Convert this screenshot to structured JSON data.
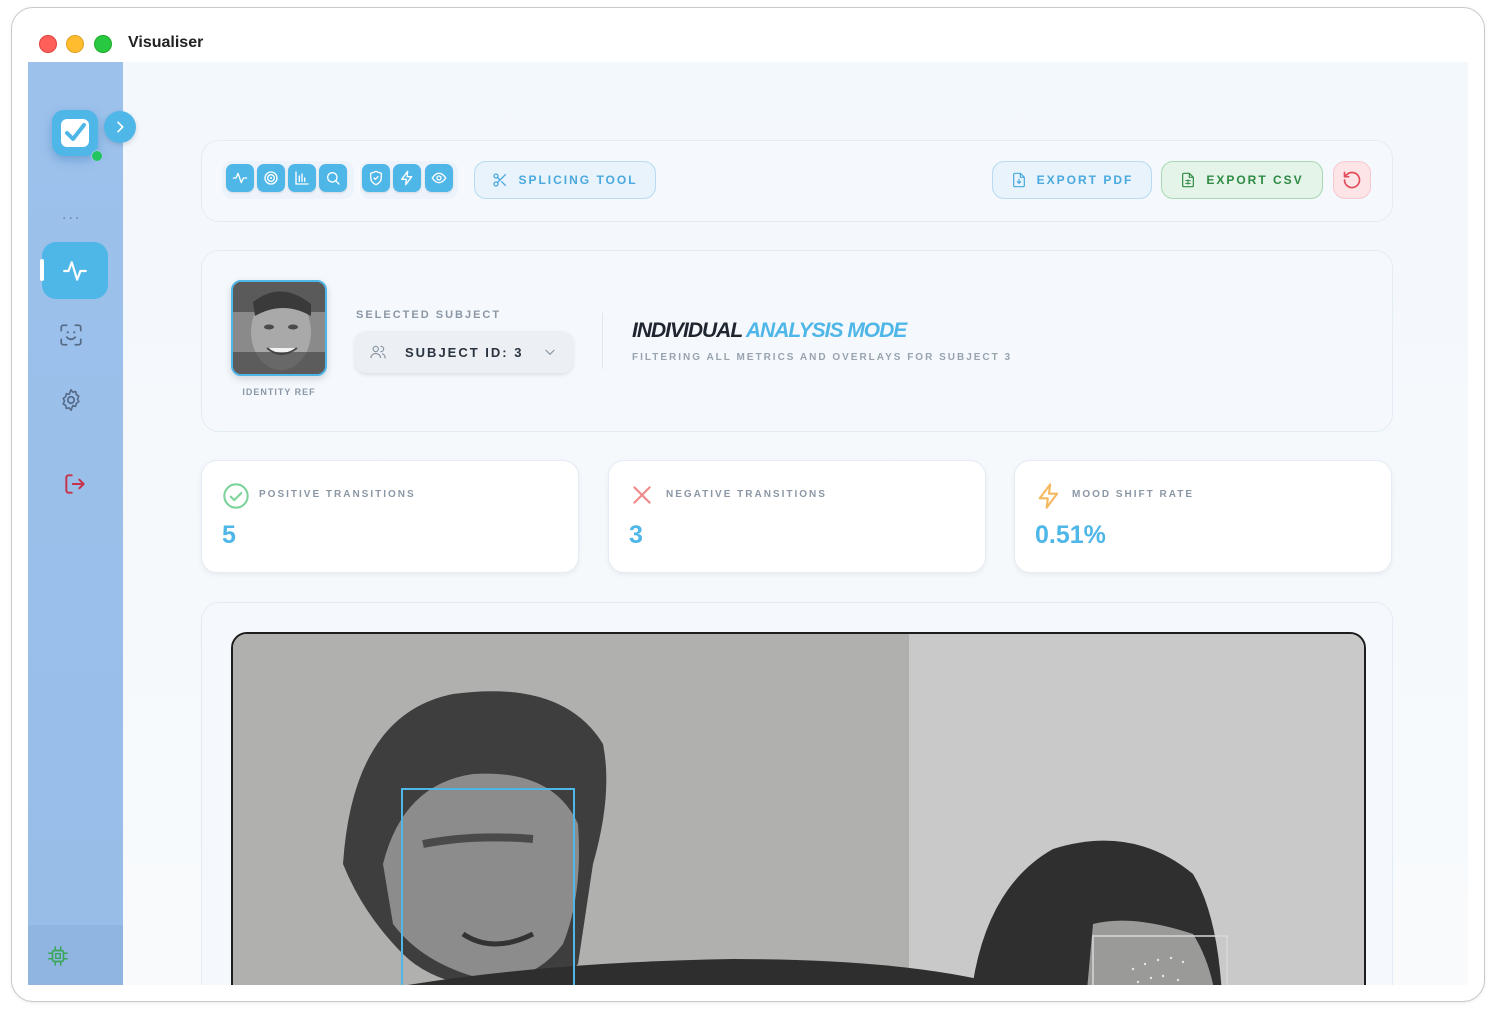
{
  "window": {
    "title": "Visualiser"
  },
  "sidebar": {
    "more_dots": "...",
    "items": [
      {
        "name": "activity",
        "active": true
      },
      {
        "name": "face-scan",
        "active": false
      },
      {
        "name": "settings",
        "active": false
      },
      {
        "name": "logout",
        "active": false
      }
    ],
    "footer_icon": "chip-icon"
  },
  "toolbar": {
    "tool_icons_group1": [
      "activity-icon",
      "target-icon",
      "bar-chart-icon",
      "search-icon"
    ],
    "tool_icons_group2": [
      "shield-icon",
      "bolt-icon",
      "eye-icon"
    ],
    "splicing_label": "SPLICING TOOL",
    "export_pdf_label": "EXPORT PDF",
    "export_csv_label": "EXPORT CSV",
    "reset_icon": "refresh-icon"
  },
  "subject": {
    "identity_label": "IDENTITY REF",
    "selected_label": "SELECTED SUBJECT",
    "selected_value": "SUBJECT ID: 3",
    "mode_title_a": "INDIVIDUAL",
    "mode_title_b": "ANALYSIS MODE",
    "mode_subtitle": "FILTERING ALL METRICS AND OVERLAYS FOR SUBJECT 3"
  },
  "stats": [
    {
      "label": "POSITIVE TRANSITIONS",
      "value": "5",
      "icon": "check-circle-icon",
      "color": "#3fbf6b"
    },
    {
      "label": "NEGATIVE TRANSITIONS",
      "value": "3",
      "icon": "x-icon",
      "color": "#f06b6b"
    },
    {
      "label": "MOOD SHIFT RATE",
      "value": "0.51%",
      "icon": "bolt-icon",
      "color": "#f5a623"
    }
  ],
  "colors": {
    "accent": "#4fb6e8",
    "sidebar": "#9cc2ec",
    "success": "#2f8a45",
    "danger": "#e24c59"
  }
}
